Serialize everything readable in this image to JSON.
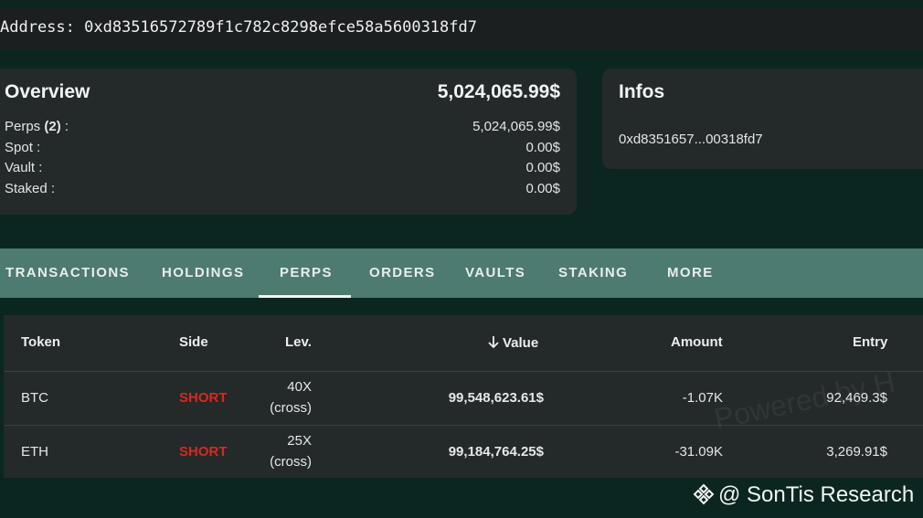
{
  "address": {
    "text": "Address: 0xd83516572789f1c782c8298efce58a5600318fd7"
  },
  "overview": {
    "title": "Overview",
    "total": "5,024,065.99$",
    "rows": [
      {
        "label_prefix": "Perps ",
        "label_count": "(2)",
        "label_suffix": " :",
        "value": "5,024,065.99$"
      },
      {
        "label": "Spot :",
        "value": "0.00$"
      },
      {
        "label": "Vault :",
        "value": "0.00$"
      },
      {
        "label": "Staked :",
        "value": "0.00$"
      }
    ]
  },
  "infos": {
    "title": "Infos",
    "address_short": "0xd8351657...00318fd7"
  },
  "tabs": [
    {
      "label": "TRANSACTIONS"
    },
    {
      "label": "HOLDINGS"
    },
    {
      "label": "PERPS",
      "active": true
    },
    {
      "label": "ORDERS"
    },
    {
      "label": "VAULTS"
    },
    {
      "label": "STAKING"
    },
    {
      "label": "MORE"
    }
  ],
  "table": {
    "headers": {
      "token": "Token",
      "side": "Side",
      "lev": "Lev.",
      "value": "Value",
      "amount": "Amount",
      "entry": "Entry"
    },
    "rows": [
      {
        "token": "BTC",
        "side": "SHORT",
        "lev_x": "40X",
        "lev_mode": "(cross)",
        "value": "99,548,623.61$",
        "amount": "-1.07K",
        "entry": "92,469.3$"
      },
      {
        "token": "ETH",
        "side": "SHORT",
        "lev_x": "25X",
        "lev_mode": "(cross)",
        "value": "99,184,764.25$",
        "amount": "-31.09K",
        "entry": "3,269.91$"
      }
    ]
  },
  "watermark": "Powered by H",
  "credit": "@ SonTis Research",
  "colors": {
    "background": "#0b2620",
    "tab_bar": "#4d7a71",
    "short": "#d32a21",
    "card": "#24292a"
  },
  "icons": {
    "sort": "arrow-down-icon",
    "logo": "binance-logo-icon"
  }
}
